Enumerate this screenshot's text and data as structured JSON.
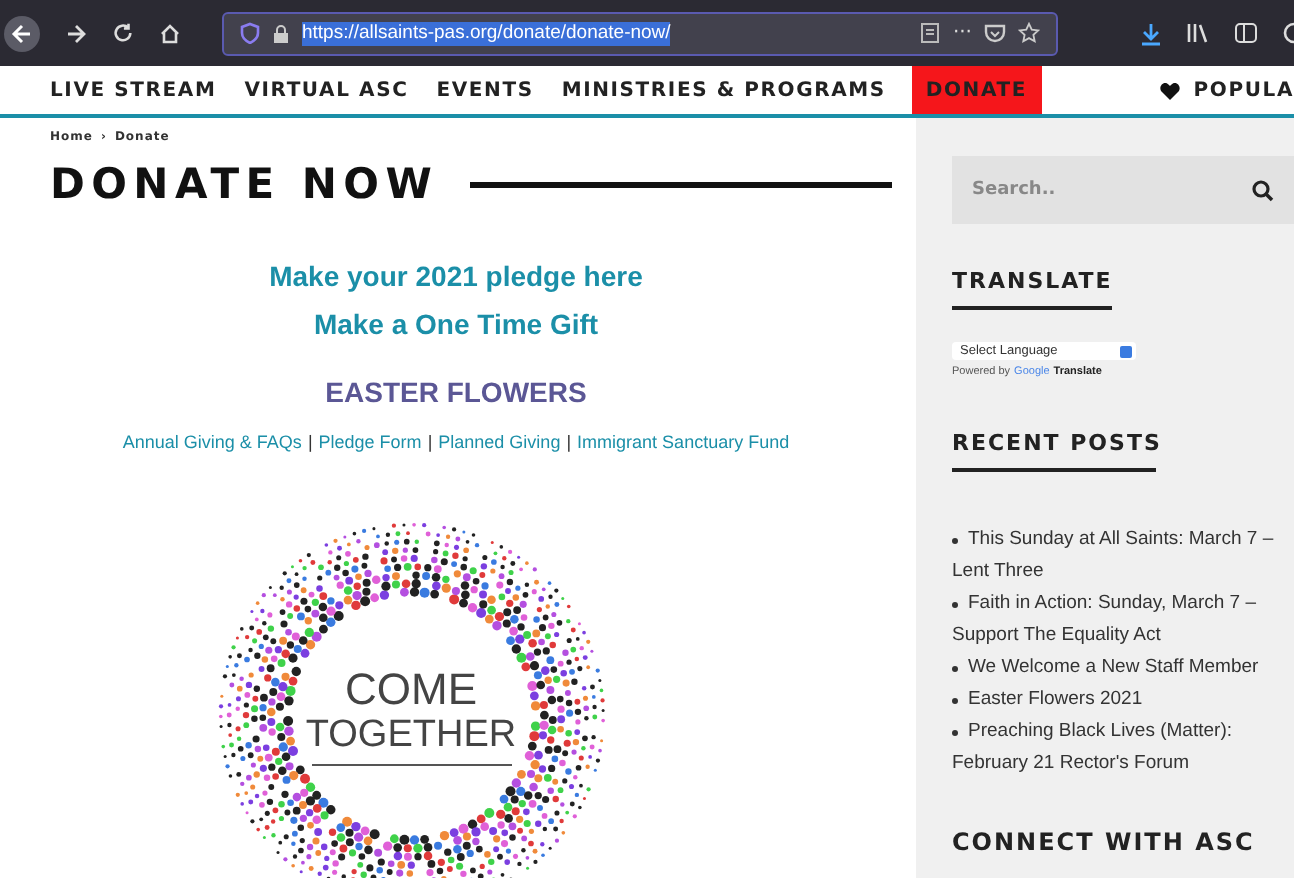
{
  "browser": {
    "url": "https://allsaints-pas.org/donate/donate-now/",
    "url_selected": true,
    "menu_dots": "···"
  },
  "nav": {
    "items": [
      {
        "label": "LIVE STREAM",
        "highlighted": false
      },
      {
        "label": "VIRTUAL ASC",
        "highlighted": false
      },
      {
        "label": "EVENTS",
        "highlighted": false
      },
      {
        "label": "MINISTRIES & PROGRAMS",
        "highlighted": false
      },
      {
        "label": "DONATE",
        "highlighted": true
      }
    ],
    "right_item": "POPULA"
  },
  "breadcrumb": {
    "items": [
      "Home",
      "Donate"
    ],
    "separator": "›"
  },
  "page_title": "DONATE NOW",
  "main_links": [
    {
      "label": "Make your 2021 pledge here",
      "kind": "pledge"
    },
    {
      "label": "Make a One Time Gift",
      "kind": "pledge"
    },
    {
      "label": "EASTER FLOWERS",
      "kind": "flowers"
    }
  ],
  "sub_links": {
    "items": [
      "Annual Giving & FAQs",
      "Pledge Form",
      "Planned Giving",
      "Immigrant Sanctuary Fund"
    ],
    "separator": "|"
  },
  "graphic": {
    "line_1": "COME",
    "line_2": "TOGETHER"
  },
  "sidebar": {
    "search": {
      "placeholder": "Search.."
    },
    "translate": {
      "heading": "TRANSLATE",
      "select": "Select Language",
      "powered_by": "Powered by",
      "google": "Google",
      "translate": "Translate"
    },
    "recent_posts": {
      "heading": "RECENT POSTS",
      "items": [
        "This Sunday at All Saints: March 7 – Lent Three",
        "Faith in Action: Sunday, March 7 – Support The Equality Act",
        "We Welcome a New Staff Member",
        "Easter Flowers 2021",
        "Preaching Black Lives (Matter): February 21 Rector's Forum"
      ]
    },
    "connect_heading": "CONNECT WITH ASC"
  }
}
